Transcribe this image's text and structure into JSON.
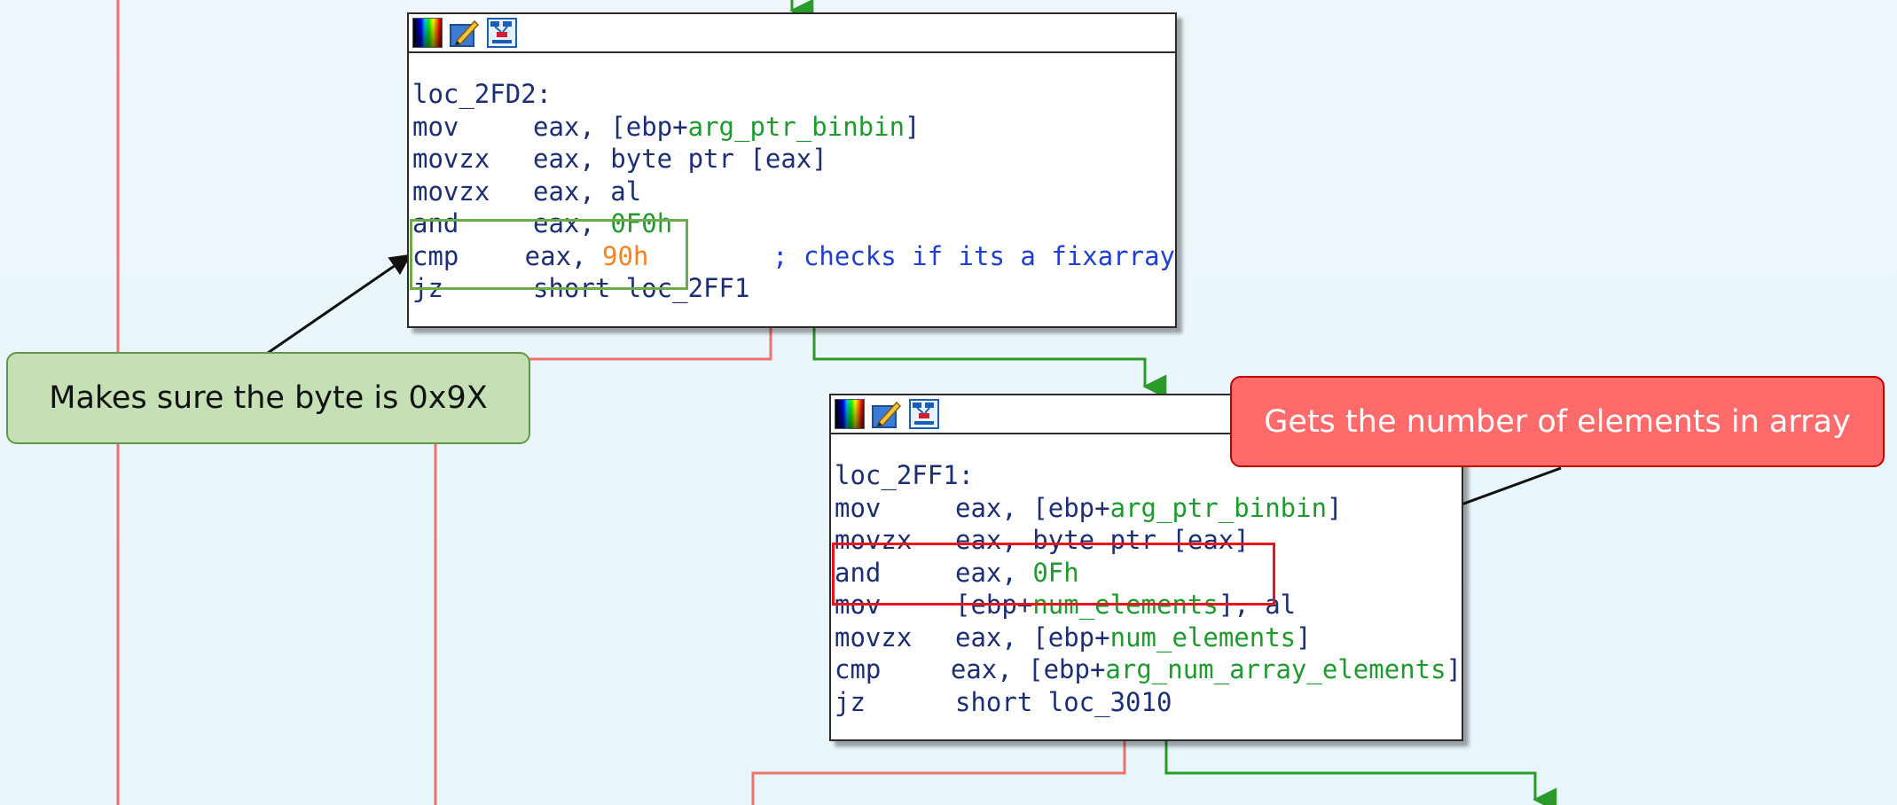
{
  "node1": {
    "lines": [
      {
        "label": "loc_2FD2:"
      },
      {
        "mnemonic": "mov",
        "parts": [
          {
            "t": "eax, [ebp+",
            "c": "plain"
          },
          {
            "t": "arg_ptr_binbin",
            "c": "arg"
          },
          {
            "t": "]",
            "c": "plain"
          }
        ]
      },
      {
        "mnemonic": "movzx",
        "parts": [
          {
            "t": "eax, byte ptr [eax]",
            "c": "plain"
          }
        ]
      },
      {
        "mnemonic": "movzx",
        "parts": [
          {
            "t": "eax, al",
            "c": "plain"
          }
        ]
      },
      {
        "mnemonic": "and",
        "parts": [
          {
            "t": "eax, ",
            "c": "plain"
          },
          {
            "t": "0F0h",
            "c": "num"
          }
        ]
      },
      {
        "mnemonic": "cmp",
        "parts": [
          {
            "t": "eax, ",
            "c": "plain"
          },
          {
            "t": "90h",
            "c": "num-orange"
          },
          {
            "t": "        ; checks if its a fixarray",
            "c": "comment"
          }
        ]
      },
      {
        "mnemonic": "jz",
        "parts": [
          {
            "t": "short loc_2FF1",
            "c": "plain"
          }
        ]
      }
    ]
  },
  "node2": {
    "lines": [
      {
        "label": "loc_2FF1:"
      },
      {
        "mnemonic": "mov",
        "parts": [
          {
            "t": "eax, [ebp+",
            "c": "plain"
          },
          {
            "t": "arg_ptr_binbin",
            "c": "arg"
          },
          {
            "t": "]",
            "c": "plain"
          }
        ]
      },
      {
        "mnemonic": "movzx",
        "parts": [
          {
            "t": "eax, byte ptr [eax]",
            "c": "plain"
          }
        ]
      },
      {
        "mnemonic": "and",
        "parts": [
          {
            "t": "eax, ",
            "c": "plain"
          },
          {
            "t": "0Fh",
            "c": "num"
          }
        ]
      },
      {
        "mnemonic": "mov",
        "parts": [
          {
            "t": "[ebp+",
            "c": "plain"
          },
          {
            "t": "num_elements",
            "c": "arg"
          },
          {
            "t": "], al",
            "c": "plain"
          }
        ]
      },
      {
        "mnemonic": "movzx",
        "parts": [
          {
            "t": "eax, [ebp+",
            "c": "plain"
          },
          {
            "t": "num_elements",
            "c": "arg"
          },
          {
            "t": "]",
            "c": "plain"
          }
        ]
      },
      {
        "mnemonic": "cmp",
        "parts": [
          {
            "t": "eax, [ebp+",
            "c": "plain"
          },
          {
            "t": "arg_num_array_elements",
            "c": "arg"
          },
          {
            "t": "]",
            "c": "plain"
          }
        ]
      },
      {
        "mnemonic": "jz",
        "parts": [
          {
            "t": "short loc_3010",
            "c": "plain"
          }
        ]
      }
    ]
  },
  "callouts": {
    "green_text": "Makes sure the byte is 0x9X",
    "red_text": "Gets the number of elements in array"
  },
  "colors": {
    "true_edge": "#2a9a2a",
    "false_edge": "#f07070",
    "green_highlight": "#6bab48",
    "red_highlight": "#e8161b"
  }
}
